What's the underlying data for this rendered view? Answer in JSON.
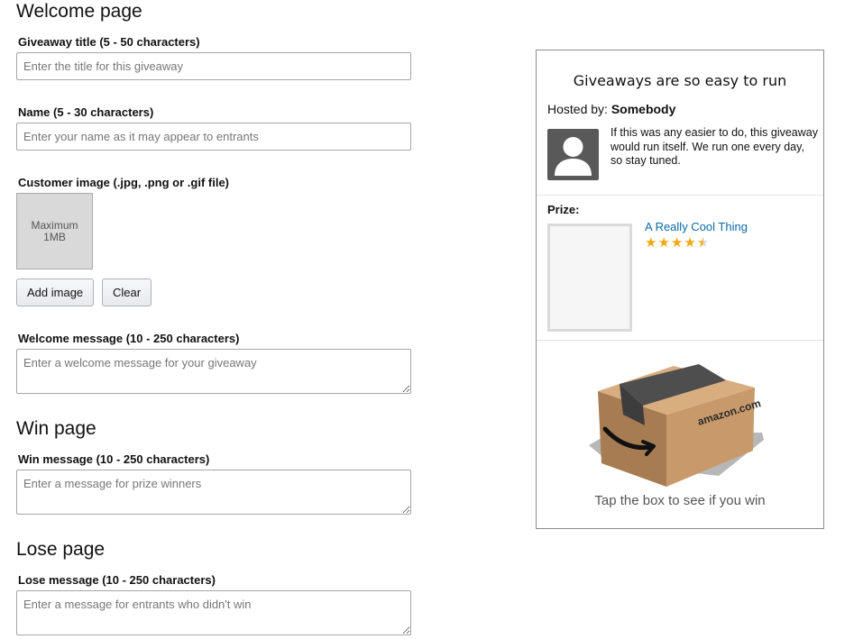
{
  "welcome": {
    "heading": "Welcome page",
    "title_label": "Giveaway title (5 - 50 characters)",
    "title_placeholder": "Enter the title for this giveaway",
    "name_label": "Name (5 - 30 characters)",
    "name_placeholder": "Enter your name as it may appear to entrants",
    "image_label": "Customer image (.jpg, .png or .gif file)",
    "image_box_text": "Maximum 1MB",
    "add_image_label": "Add image",
    "clear_label": "Clear",
    "message_label": "Welcome message (10 - 250 characters)",
    "message_placeholder": "Enter a welcome message for your giveaway"
  },
  "win": {
    "heading": "Win page",
    "message_label": "Win message (10 - 250 characters)",
    "message_placeholder": "Enter a message for prize winners"
  },
  "lose": {
    "heading": "Lose page",
    "message_label": "Lose message (10 - 250 characters)",
    "message_placeholder": "Enter a message for entrants who didn't win"
  },
  "preview": {
    "title": "Giveaways are so easy to run",
    "hosted_by_label": "Hosted by:",
    "host_name": "Somebody",
    "description": "If this was any easier to do, this giveaway would run itself. We run one every day, so stay tuned.",
    "prize_label": "Prize:",
    "prize_name": "A Really Cool Thing",
    "prize_rating": 4.5,
    "box_brand": "amazon.com",
    "tap_text": "Tap the box to see if you win",
    "link_color": "#0a6aa6",
    "star_color": "#f3a812"
  }
}
